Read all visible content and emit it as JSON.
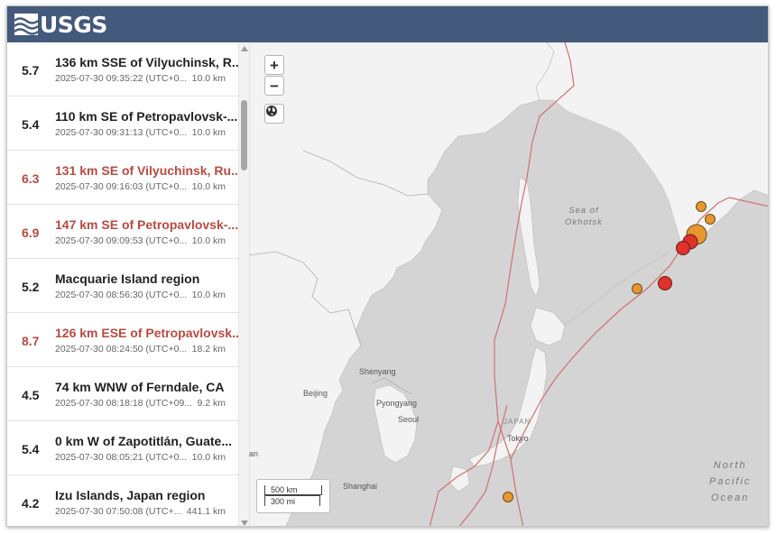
{
  "header": {
    "logo_text": "USGS"
  },
  "events": [
    {
      "mag": "5.7",
      "title": "136 km SSE of Vilyuchinsk, R...",
      "time": "2025-07-30 09:35:22 (UTC+0...",
      "depth": "10.0 km",
      "significant": false
    },
    {
      "mag": "5.4",
      "title": "110 km SE of Petropavlovsk-...",
      "time": "2025-07-30 09:31:13 (UTC+0...",
      "depth": "10.0 km",
      "significant": false
    },
    {
      "mag": "6.3",
      "title": "131 km SE of Vilyuchinsk, Ru...",
      "time": "2025-07-30 09:16:03 (UTC+0...",
      "depth": "10.0 km",
      "significant": true
    },
    {
      "mag": "6.9",
      "title": "147 km SE of Petropavlovsk-...",
      "time": "2025-07-30 09:09:53 (UTC+0...",
      "depth": "10.0 km",
      "significant": true
    },
    {
      "mag": "5.2",
      "title": "Macquarie Island region",
      "time": "2025-07-30 08:56:30 (UTC+0...",
      "depth": "10.0 km",
      "significant": false
    },
    {
      "mag": "8.7",
      "title": "126 km ESE of Petropavlovsk...",
      "time": "2025-07-30 08:24:50 (UTC+0...",
      "depth": "18.2 km",
      "significant": true
    },
    {
      "mag": "4.5",
      "title": "74 km WNW of Ferndale, CA",
      "time": "2025-07-30 08:18:18 (UTC+09...",
      "depth": "9.2 km",
      "significant": false
    },
    {
      "mag": "5.4",
      "title": "0 km W of Zapotitlán, Guate...",
      "time": "2025-07-30 08:05:21 (UTC+0...",
      "depth": "10.0 km",
      "significant": false
    },
    {
      "mag": "4.2",
      "title": "Izu Islands, Japan region",
      "time": "2025-07-30 07:50:08 (UTC+...",
      "depth": "441.1 km",
      "significant": false
    }
  ],
  "map": {
    "zoom_in": "+",
    "zoom_out": "−",
    "globe_icon": "globe-icon",
    "labels": {
      "sea_of_okhotsk_1": "Sea of",
      "sea_of_okhotsk_2": "Okhotsk",
      "north_pacific_1": "North",
      "north_pacific_2": "Pacific",
      "north_pacific_3": "Ocean",
      "shenyang": "Shenyang",
      "beijing": "Beijing",
      "pyongyang": "Pyongyang",
      "seoul": "Seoul",
      "japan": "JAPAN",
      "tokyo": "Tokyo",
      "shanghai": "Shanghai",
      "edge_an": "an"
    },
    "scale": {
      "km": "500 km",
      "mi": "300 mi"
    },
    "colors": {
      "orange": "#e8962e",
      "red": "#e0312a",
      "plate": "#d07070",
      "land": "#f3f3f3",
      "water": "#d4d4d4"
    }
  }
}
